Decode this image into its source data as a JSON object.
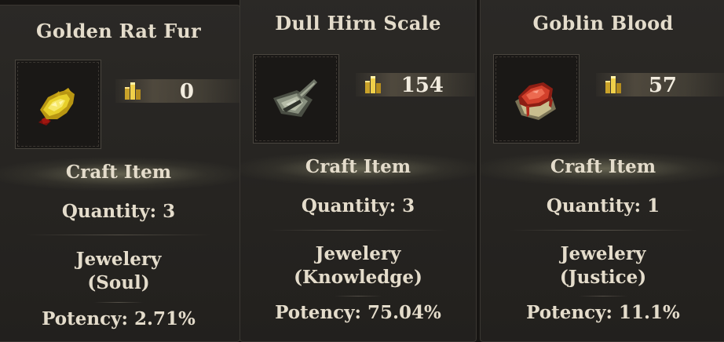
{
  "cards": [
    {
      "title": "Golden Rat Fur",
      "icon": "golden-rat-fur-icon",
      "value": "0",
      "category": "Craft Item",
      "quantity": "Quantity: 3",
      "use_line1": "Jewelery",
      "use_line2": "(Soul)",
      "potency": "Potency: 2.71%"
    },
    {
      "title": "Dull Hirn Scale",
      "icon": "dull-hirn-scale-icon",
      "value": "154",
      "category": "Craft Item",
      "quantity": "Quantity: 3",
      "use_line1": "Jewelery",
      "use_line2": "(Knowledge)",
      "potency": "Potency: 75.04%"
    },
    {
      "title": "Goblin Blood",
      "icon": "goblin-blood-icon",
      "value": "57",
      "category": "Craft Item",
      "quantity": "Quantity: 1",
      "use_line1": "Jewelery",
      "use_line2": "(Justice)",
      "potency": "Potency: 11.1%"
    }
  ],
  "colors": {
    "panel": "#24221f",
    "text": "#e4dccb",
    "gold": "#e8c33a"
  }
}
